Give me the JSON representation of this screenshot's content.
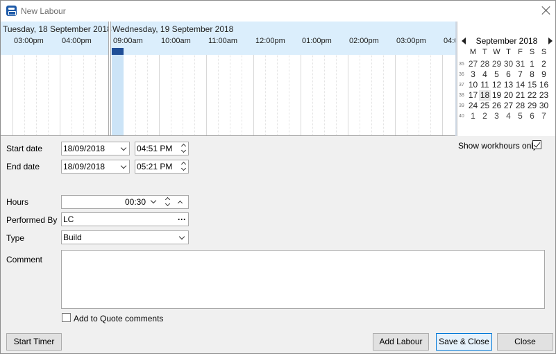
{
  "window": {
    "title": "New Labour"
  },
  "scheduler": {
    "days": [
      {
        "label": "Tuesday, 18 September 2018"
      },
      {
        "label": "Wednesday, 19 September 2018"
      }
    ],
    "times": [
      "03:00pm",
      "04:00pm",
      "09:00am",
      "10:00am",
      "11:00am",
      "12:00pm",
      "01:00pm",
      "02:00pm",
      "03:00pm",
      "04:0"
    ]
  },
  "calendar": {
    "month_label": "September 2018",
    "dow": [
      "M",
      "T",
      "W",
      "T",
      "F",
      "S",
      "S"
    ],
    "weeks": [
      {
        "wk": "35",
        "days": [
          "27",
          "28",
          "29",
          "30",
          "31",
          "1",
          "2"
        ]
      },
      {
        "wk": "36",
        "days": [
          "3",
          "4",
          "5",
          "6",
          "7",
          "8",
          "9"
        ]
      },
      {
        "wk": "37",
        "days": [
          "10",
          "11",
          "12",
          "13",
          "14",
          "15",
          "16"
        ]
      },
      {
        "wk": "38",
        "days": [
          "17",
          "18",
          "19",
          "20",
          "21",
          "22",
          "23"
        ]
      },
      {
        "wk": "39",
        "days": [
          "24",
          "25",
          "26",
          "27",
          "28",
          "29",
          "30"
        ]
      },
      {
        "wk": "40",
        "days": [
          "1",
          "2",
          "3",
          "4",
          "5",
          "6",
          "7"
        ]
      }
    ],
    "today": "18"
  },
  "form": {
    "start_date_label": "Start date",
    "start_date": "18/09/2018",
    "start_time": "04:51 PM",
    "end_date_label": "End date",
    "end_date": "18/09/2018",
    "end_time": "05:21 PM",
    "show_workhours_label": "Show workhours only",
    "show_workhours_checked": true,
    "hours_label": "Hours",
    "hours_value": "00:30",
    "performed_by_label": "Performed By",
    "performed_by_value": "LC",
    "performed_by_more": "···",
    "type_label": "Type",
    "type_value": "Build",
    "comment_label": "Comment",
    "comment_value": "",
    "add_to_quote_label": "Add to Quote comments",
    "add_to_quote_checked": false
  },
  "buttons": {
    "start_timer": "Start Timer",
    "add_labour": "Add Labour",
    "save_close": "Save & Close",
    "close": "Close"
  }
}
